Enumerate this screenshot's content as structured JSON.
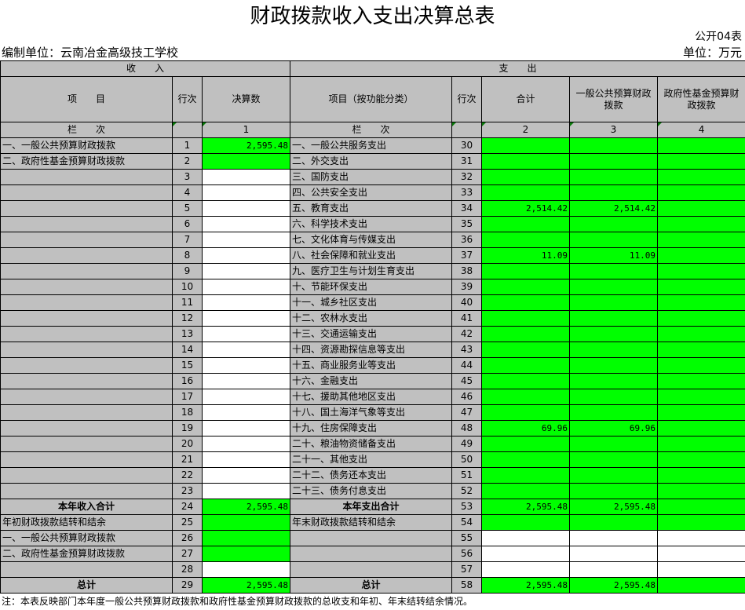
{
  "title": "财政拨款收入支出决算总表",
  "form_no": "公开04表",
  "unit_left": "编制单位：云南冶金高级技工学校",
  "unit_right": "单位：万元",
  "headers": {
    "income": "收　　入",
    "expense": "支　　出",
    "item": "项　　目",
    "row_no": "行次",
    "final_amount": "决算数",
    "func_item": "项目（按功能分类）",
    "row_no2": "行次",
    "total": "合计",
    "general": "一般公共预算财政拨款",
    "fund": "政府性基金预算财政拨款",
    "lanci": "栏　　次",
    "lanci2": "栏　　次",
    "c1": "1",
    "c2": "2",
    "c3": "3",
    "c4": "4"
  },
  "rows": [
    {
      "inc": "一、一般公共预算财政拨款",
      "n1": "1",
      "amt": "2,595.48",
      "exp": "一、一般公共服务支出",
      "n2": "30",
      "total": "",
      "gen": "",
      "fund": ""
    },
    {
      "inc": "二、政府性基金预算财政拨款",
      "n1": "2",
      "amt": "",
      "exp": "二、外交支出",
      "n2": "31",
      "total": "",
      "gen": "",
      "fund": ""
    },
    {
      "inc": "",
      "n1": "3",
      "amt": "",
      "exp": "三、国防支出",
      "n2": "32",
      "total": "",
      "gen": "",
      "fund": ""
    },
    {
      "inc": "",
      "n1": "4",
      "amt": "",
      "exp": "四、公共安全支出",
      "n2": "33",
      "total": "",
      "gen": "",
      "fund": ""
    },
    {
      "inc": "",
      "n1": "5",
      "amt": "",
      "exp": "五、教育支出",
      "n2": "34",
      "total": "2,514.42",
      "gen": "2,514.42",
      "fund": ""
    },
    {
      "inc": "",
      "n1": "6",
      "amt": "",
      "exp": "六、科学技术支出",
      "n2": "35",
      "total": "",
      "gen": "",
      "fund": ""
    },
    {
      "inc": "",
      "n1": "7",
      "amt": "",
      "exp": "七、文化体育与传媒支出",
      "n2": "36",
      "total": "",
      "gen": "",
      "fund": ""
    },
    {
      "inc": "",
      "n1": "8",
      "amt": "",
      "exp": "八、社会保障和就业支出",
      "n2": "37",
      "total": "11.09",
      "gen": "11.09",
      "fund": ""
    },
    {
      "inc": "",
      "n1": "9",
      "amt": "",
      "exp": "九、医疗卫生与计划生育支出",
      "n2": "38",
      "total": "",
      "gen": "",
      "fund": ""
    },
    {
      "inc": "",
      "n1": "10",
      "amt": "",
      "exp": "十、节能环保支出",
      "n2": "39",
      "total": "",
      "gen": "",
      "fund": ""
    },
    {
      "inc": "",
      "n1": "11",
      "amt": "",
      "exp": "十一、城乡社区支出",
      "n2": "40",
      "total": "",
      "gen": "",
      "fund": ""
    },
    {
      "inc": "",
      "n1": "12",
      "amt": "",
      "exp": "十二、农林水支出",
      "n2": "41",
      "total": "",
      "gen": "",
      "fund": ""
    },
    {
      "inc": "",
      "n1": "13",
      "amt": "",
      "exp": "十三、交通运输支出",
      "n2": "42",
      "total": "",
      "gen": "",
      "fund": ""
    },
    {
      "inc": "",
      "n1": "14",
      "amt": "",
      "exp": "十四、资源勘探信息等支出",
      "n2": "43",
      "total": "",
      "gen": "",
      "fund": ""
    },
    {
      "inc": "",
      "n1": "15",
      "amt": "",
      "exp": "十五、商业服务业等支出",
      "n2": "44",
      "total": "",
      "gen": "",
      "fund": ""
    },
    {
      "inc": "",
      "n1": "16",
      "amt": "",
      "exp": "十六、金融支出",
      "n2": "45",
      "total": "",
      "gen": "",
      "fund": ""
    },
    {
      "inc": "",
      "n1": "17",
      "amt": "",
      "exp": "十七、援助其他地区支出",
      "n2": "46",
      "total": "",
      "gen": "",
      "fund": ""
    },
    {
      "inc": "",
      "n1": "18",
      "amt": "",
      "exp": "十八、国土海洋气象等支出",
      "n2": "47",
      "total": "",
      "gen": "",
      "fund": ""
    },
    {
      "inc": "",
      "n1": "19",
      "amt": "",
      "exp": "十九、住房保障支出",
      "n2": "48",
      "total": "69.96",
      "gen": "69.96",
      "fund": ""
    },
    {
      "inc": "",
      "n1": "20",
      "amt": "",
      "exp": "二十、粮油物资储备支出",
      "n2": "49",
      "total": "",
      "gen": "",
      "fund": ""
    },
    {
      "inc": "",
      "n1": "21",
      "amt": "",
      "exp": "二十一、其他支出",
      "n2": "50",
      "total": "",
      "gen": "",
      "fund": ""
    },
    {
      "inc": "",
      "n1": "22",
      "amt": "",
      "exp": "二十二、债务还本支出",
      "n2": "51",
      "total": "",
      "gen": "",
      "fund": ""
    },
    {
      "inc": "",
      "n1": "23",
      "amt": "",
      "exp": "二十三、债务付息支出",
      "n2": "52",
      "total": "",
      "gen": "",
      "fund": ""
    }
  ],
  "year_total": {
    "inc": "本年收入合计",
    "n1": "24",
    "amt": "2,595.48",
    "exp": "本年支出合计",
    "n2": "53",
    "total": "2,595.48",
    "gen": "2,595.48",
    "fund": ""
  },
  "carry": [
    {
      "inc": "年初财政拨款结转和结余",
      "n1": "25",
      "amt": "",
      "exp": "年末财政拨款结转和结余",
      "n2": "54",
      "total": "",
      "gen": "",
      "fund": ""
    },
    {
      "inc": "一、一般公共预算财政拨款",
      "n1": "26",
      "amt": "",
      "exp": "",
      "n2": "55",
      "total": "",
      "gen": "",
      "fund": ""
    },
    {
      "inc": "二、政府性基金预算财政拨款",
      "n1": "27",
      "amt": "",
      "exp": "",
      "n2": "56",
      "total": "",
      "gen": "",
      "fund": ""
    },
    {
      "inc": "",
      "n1": "28",
      "amt": "",
      "exp": "",
      "n2": "57",
      "total": "",
      "gen": "",
      "fund": ""
    }
  ],
  "grand_total": {
    "inc": "总计",
    "n1": "29",
    "amt": "2,595.48",
    "exp": "总计",
    "n2": "58",
    "total": "2,595.48",
    "gen": "2,595.48",
    "fund": ""
  },
  "note": "注：本表反映部门本年度一般公共预算财政拨款和政府性基金预算财政拨款的总收支和年初、年末结转结余情况。"
}
